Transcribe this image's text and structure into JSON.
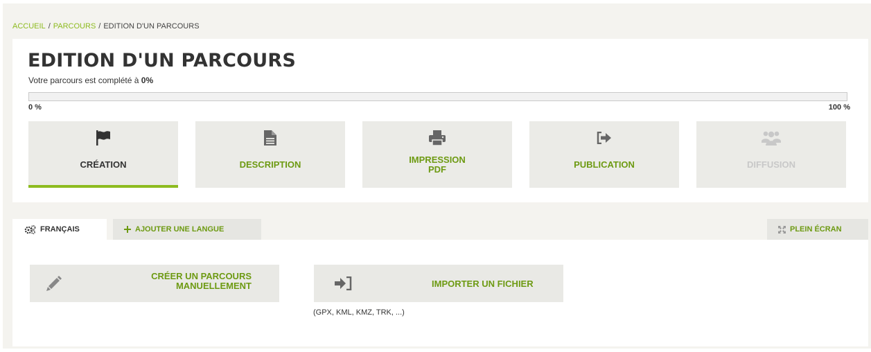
{
  "breadcrumb": {
    "home": "ACCUEIL",
    "sep": "/",
    "parcours": "PARCOURS",
    "current": "EDITION D'UN PARCOURS"
  },
  "page": {
    "title": "EDITION D'UN PARCOURS",
    "completion_text": "Votre parcours est complété à",
    "completion_value": "0%",
    "progress_fraction": 0,
    "progress_min_label": "0 %",
    "progress_max_label": "100 %"
  },
  "steps": [
    {
      "label_line1": "CRÉATION",
      "label_line2": "",
      "icon": "flag-icon",
      "state": "active"
    },
    {
      "label_line1": "DESCRIPTION",
      "label_line2": "",
      "icon": "document-icon",
      "state": "normal"
    },
    {
      "label_line1": "IMPRESSION",
      "label_line2": "PDF",
      "icon": "printer-icon",
      "state": "normal"
    },
    {
      "label_line1": "PUBLICATION",
      "label_line2": "",
      "icon": "sign-out-icon",
      "state": "normal"
    },
    {
      "label_line1": "DIFFUSION",
      "label_line2": "",
      "icon": "group-icon",
      "state": "disabled"
    }
  ],
  "tabs": {
    "language": "FRANÇAIS",
    "add_language": "AJOUTER UNE LANGUE",
    "fullscreen": "PLEIN ÉCRAN"
  },
  "actions": {
    "manual_line1": "CRÉER UN PARCOURS",
    "manual_line2": "MANUELLEMENT",
    "import_label": "IMPORTER UN FICHIER",
    "import_hint": "(GPX, KML, KMZ, TRK, ...)"
  },
  "colors": {
    "accent": "#8dbb1f",
    "accent_text": "#6d9a12",
    "background": "#f4f3ef",
    "tile": "#ebebe7"
  }
}
